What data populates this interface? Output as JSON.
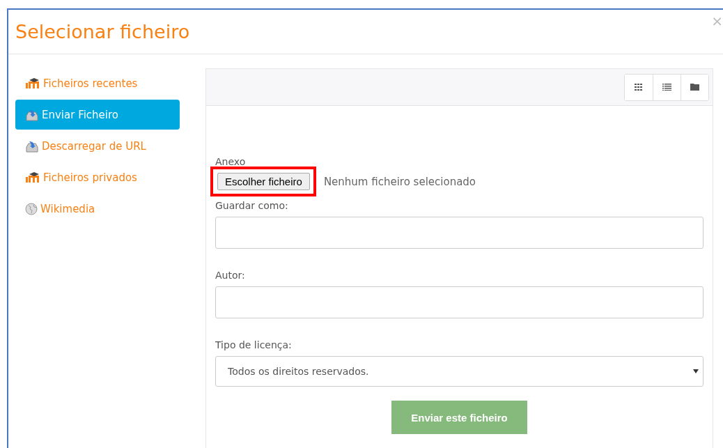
{
  "window": {
    "title": "Selecionar ficheiro",
    "close": "×"
  },
  "sidebar": {
    "items": [
      {
        "label": "Ficheiros recentes",
        "kind": "moodle",
        "selected": false
      },
      {
        "label": "Enviar Ficheiro",
        "kind": "upload",
        "selected": true
      },
      {
        "label": "Descarregar de URL",
        "kind": "upload",
        "selected": false
      },
      {
        "label": "Ficheiros privados",
        "kind": "moodle",
        "selected": false
      },
      {
        "label": "Wikimedia",
        "kind": "globe",
        "selected": false
      }
    ]
  },
  "toolbar": {
    "views": [
      {
        "kind": "grid"
      },
      {
        "kind": "list"
      },
      {
        "kind": "folder"
      }
    ]
  },
  "form": {
    "attachment": {
      "label": "Anexo",
      "button": "Escolher ficheiro",
      "status": "Nenhum ficheiro selecionado",
      "highlighted": true
    },
    "save_as": {
      "label": "Guardar como:"
    },
    "author": {
      "label": "Autor:"
    },
    "license": {
      "label": "Tipo de licença:",
      "value": "Todos os direitos reservados."
    },
    "submit": "Enviar este ficheiro"
  }
}
